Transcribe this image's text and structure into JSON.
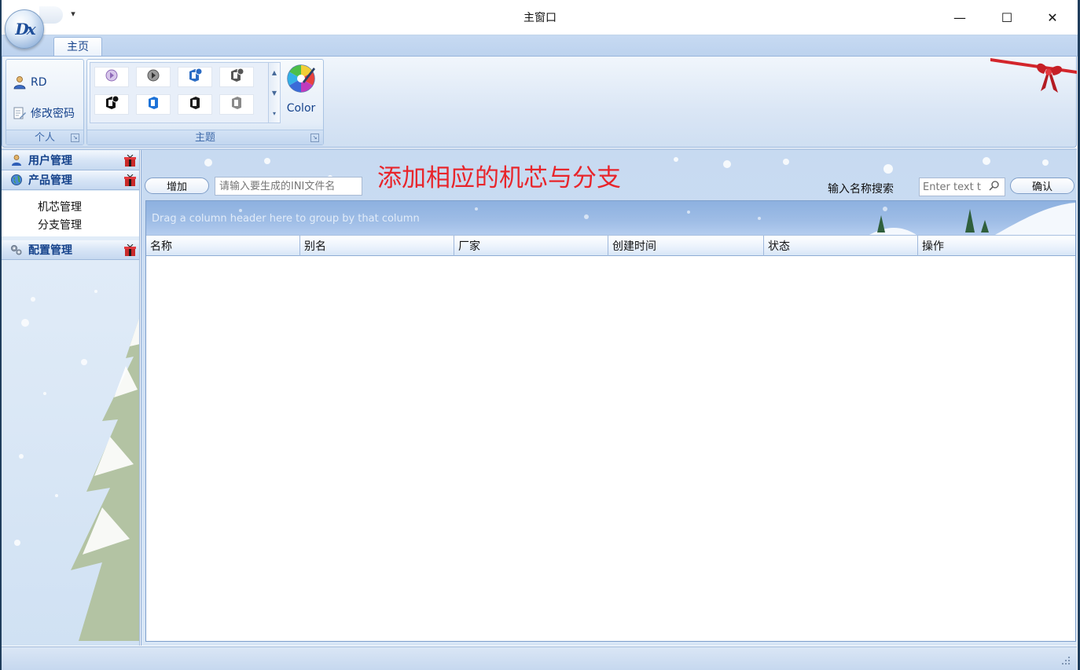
{
  "window": {
    "title": "主窗口",
    "minimize_glyph": "—",
    "maximize_glyph": "☐",
    "close_glyph": "✕"
  },
  "app_orb": {
    "monogram": "Dx"
  },
  "quick_access": {
    "dropdown_glyph": "▾"
  },
  "ribbon": {
    "tabs": [
      {
        "label": "主页",
        "active": true
      }
    ],
    "groups": {
      "personal": {
        "label": "个人",
        "user_label": "RD",
        "change_password_label": "修改密码"
      },
      "theme": {
        "label": "主题",
        "color_label": "Color",
        "scroll_up_glyph": "▲",
        "scroll_down_glyph": "▼"
      }
    }
  },
  "nav": {
    "groups": [
      {
        "label": "用户管理",
        "icon": "user-icon"
      },
      {
        "label": "产品管理",
        "icon": "product-icon",
        "items": [
          "机芯管理",
          "分支管理"
        ]
      },
      {
        "label": "配置管理",
        "icon": "config-icon"
      }
    ]
  },
  "main": {
    "annotation": "添加相应的机芯与分支",
    "add_button_label": "增加",
    "ini_input_placeholder": "请输入要生成的INI文件名",
    "search_label": "输入名称搜索",
    "search_placeholder": "Enter text t",
    "confirm_button_label": "确认",
    "grid": {
      "group_hint": "Drag a column header here to group by that column",
      "columns": [
        "名称",
        "别名",
        "厂家",
        "创建时间",
        "状态",
        "操作"
      ],
      "rows": []
    }
  },
  "colors": {
    "accent_text": "#15428b",
    "annotation_red": "#e8252b",
    "ribbon_bg": "#dae6f5",
    "group_panel_blue": "#9fbde6"
  }
}
